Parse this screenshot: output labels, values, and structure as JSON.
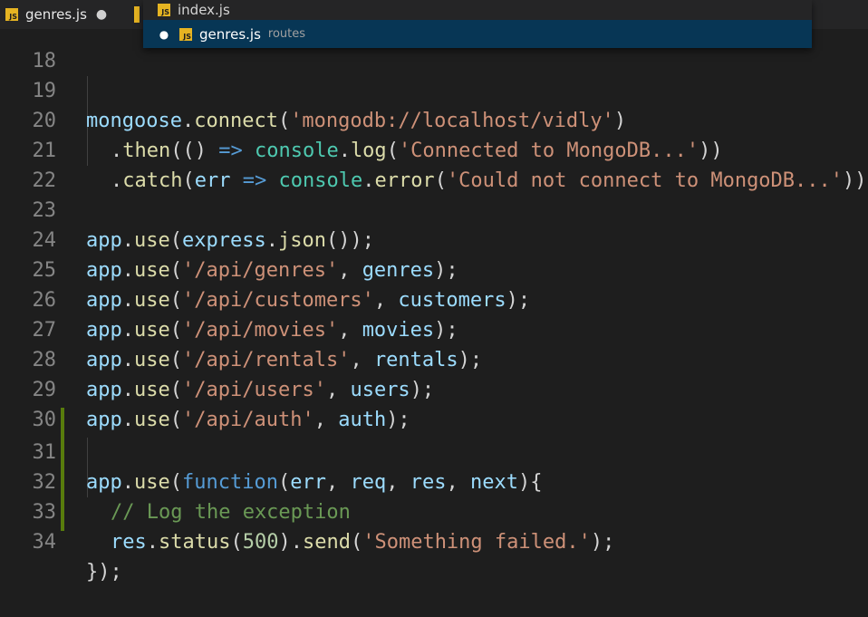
{
  "tabs": [
    {
      "label": "genres.js",
      "icon": "js-file-icon",
      "modified": true
    }
  ],
  "quick_open": {
    "items": [
      {
        "label": "index.js",
        "description": ""
      },
      {
        "label": "genres.js",
        "description": "routes",
        "selected": true
      }
    ]
  },
  "editor": {
    "partial_top_line_number": "18",
    "lines": [
      {
        "n": "19"
      },
      {
        "n": "20"
      },
      {
        "n": "21"
      },
      {
        "n": "22"
      },
      {
        "n": "23"
      },
      {
        "n": "24"
      },
      {
        "n": "25"
      },
      {
        "n": "26"
      },
      {
        "n": "27"
      },
      {
        "n": "28"
      },
      {
        "n": "29"
      },
      {
        "n": "30"
      },
      {
        "n": "31"
      },
      {
        "n": "32"
      },
      {
        "n": "33"
      },
      {
        "n": "34"
      }
    ],
    "code": {
      "l19": [
        "mongoose",
        ".",
        "connect",
        "(",
        "'mongodb://localhost/vidly'",
        ")"
      ],
      "l20": [
        ".",
        "then",
        "(() ",
        "=>",
        " ",
        "console",
        ".",
        "log",
        "(",
        "'Connected to MongoDB...'",
        "))"
      ],
      "l21": [
        ".",
        "catch",
        "(",
        "err",
        " ",
        "=>",
        " ",
        "console",
        ".",
        "error",
        "(",
        "'Could not connect to MongoDB...'",
        "))"
      ],
      "l23": [
        "app",
        ".",
        "use",
        "(",
        "express",
        ".",
        "json",
        "());"
      ],
      "l24": [
        "app",
        ".",
        "use",
        "(",
        "'/api/genres'",
        ", ",
        "genres",
        ");"
      ],
      "l25": [
        "app",
        ".",
        "use",
        "(",
        "'/api/customers'",
        ", ",
        "customers",
        ");"
      ],
      "l26": [
        "app",
        ".",
        "use",
        "(",
        "'/api/movies'",
        ", ",
        "movies",
        ");"
      ],
      "l27": [
        "app",
        ".",
        "use",
        "(",
        "'/api/rentals'",
        ", ",
        "rentals",
        ");"
      ],
      "l28": [
        "app",
        ".",
        "use",
        "(",
        "'/api/users'",
        ", ",
        "users",
        ");"
      ],
      "l29": [
        "app",
        ".",
        "use",
        "(",
        "'/api/auth'",
        ", ",
        "auth",
        ");"
      ],
      "l31": [
        "app",
        ".",
        "use",
        "(",
        "function",
        "(",
        "err",
        ", ",
        "req",
        ", ",
        "res",
        ", ",
        "next",
        "){"
      ],
      "l32": [
        "// Log the exception"
      ],
      "l33": [
        "res",
        ".",
        "status",
        "(",
        "500",
        ").",
        "send",
        "(",
        "'Something failed.'",
        ");"
      ],
      "l34": [
        "});"
      ]
    }
  },
  "colors": {
    "background": "#1e1e1e",
    "selection": "#073655",
    "string": "#ce9178",
    "keyword": "#569cd6",
    "identifier": "#9cdcfe",
    "function": "#dcdcaa",
    "comment": "#6a9955",
    "modified_gutter": "#587c0c"
  }
}
